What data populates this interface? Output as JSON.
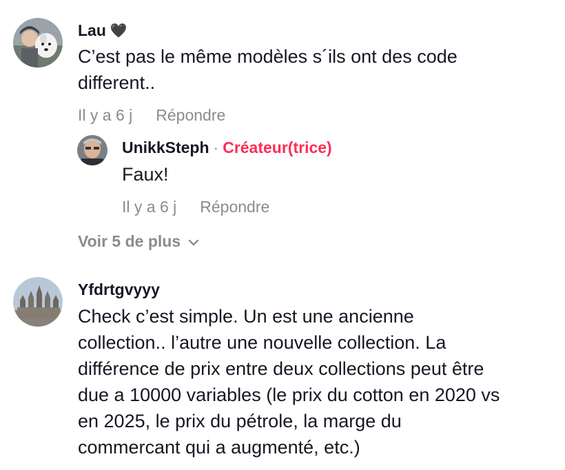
{
  "comments": [
    {
      "username": "Lau",
      "badge": "🖤",
      "text_lines": [
        "C’est pas le même modèles s´ils ont des code",
        "different.."
      ],
      "time": "Il y a 6 j",
      "reply_label": "Répondre",
      "replies": [
        {
          "username": "UnikkSteph",
          "separator": "·",
          "creator_label": "Créateur(trice)",
          "text": "Faux!",
          "time": "Il y a 6 j",
          "reply_label": "Répondre"
        }
      ],
      "more_label": "Voir 5 de plus"
    },
    {
      "username": "Yfdrtgvyyy",
      "text_lines": [
        "Check c’est simple. Un est une ancienne",
        "collection.. l’autre une nouvelle collection. La",
        "différence de prix entre deux collections peut être",
        "due a 10000 variables (le prix du cotton en 2020 vs",
        "en 2025, le prix du pétrole, la marge du",
        "commercant qui a augmenté, etc.)"
      ]
    }
  ],
  "icons": {
    "more_chevron": "chevron-down-icon",
    "heart": "black-heart-emoji"
  },
  "colors": {
    "creator": "#fe2c55",
    "meta": "#8a8b91",
    "text": "#161823"
  }
}
